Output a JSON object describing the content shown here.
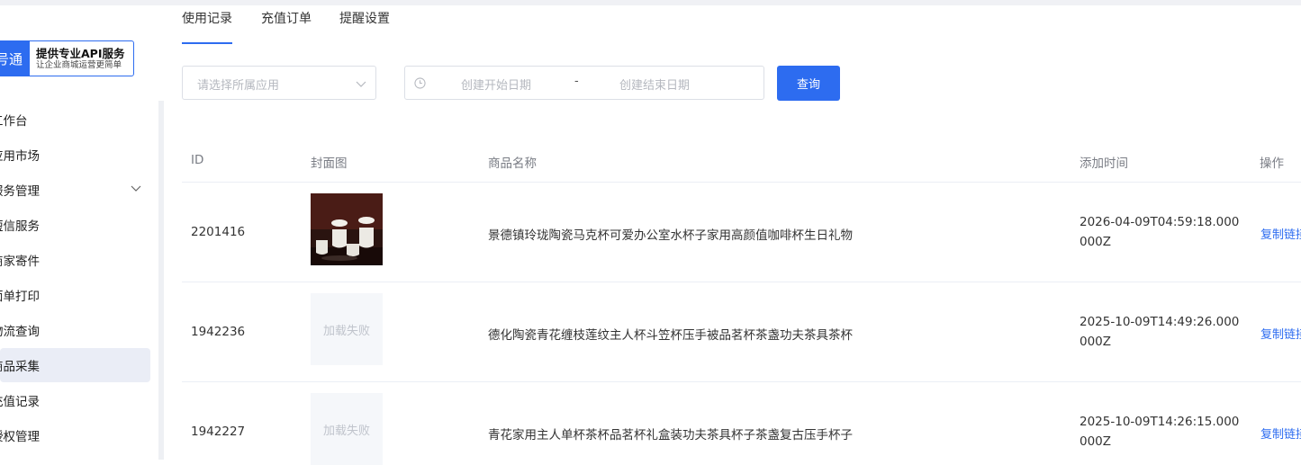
{
  "brand": {
    "left_text": "号通",
    "title": "提供专业API服务",
    "subtitle": "让企业商城运营更简单"
  },
  "sidebar": {
    "items": [
      {
        "label": "工作台"
      },
      {
        "label": "应用市场"
      },
      {
        "label": "服务管理"
      },
      {
        "label": "短信服务"
      },
      {
        "label": "商家寄件"
      },
      {
        "label": "面单打印"
      },
      {
        "label": "物流查询"
      },
      {
        "label": "商品采集"
      },
      {
        "label": "充值记录"
      },
      {
        "label": "授权管理"
      }
    ],
    "active_index": 7
  },
  "tabs": [
    {
      "label": "使用记录"
    },
    {
      "label": "充值订单"
    },
    {
      "label": "提醒设置"
    }
  ],
  "filters": {
    "app_select_placeholder": "请选择所属应用",
    "start_date_placeholder": "创建开始日期",
    "date_separator": "-",
    "end_date_placeholder": "创建结束日期",
    "query_label": "查询"
  },
  "table": {
    "headers": {
      "id": "ID",
      "cover": "封面图",
      "name": "商品名称",
      "added_time": "添加时间",
      "action": "操作"
    },
    "rows": [
      {
        "id": "2201416",
        "cover": "image",
        "name": "景德镇玲珑陶瓷马克杯可爱办公室水杯子家用高颜值咖啡杯生日礼物",
        "added_time": "2026-04-09T04:59:18.000000Z",
        "action": "复制链接"
      },
      {
        "id": "1942236",
        "cover": "加载失败",
        "name": "德化陶瓷青花缠枝莲纹主人杯斗笠杯压手被品茗杯茶盏功夫茶具茶杯",
        "added_time": "2025-10-09T14:49:26.000000Z",
        "action": "复制链接"
      },
      {
        "id": "1942227",
        "cover": "加载失败",
        "name": "青花家用主人单杯茶杯品茗杯礼盒装功夫茶具杯子茶盏复古压手杯子",
        "added_time": "2025-10-09T14:26:15.000000Z",
        "action": "复制链接"
      }
    ]
  },
  "colors": {
    "primary": "#2d6cf0",
    "active_menu_bg": "#eaedf6",
    "placeholder": "#b5b8bf",
    "header_text": "#7a7d85"
  }
}
